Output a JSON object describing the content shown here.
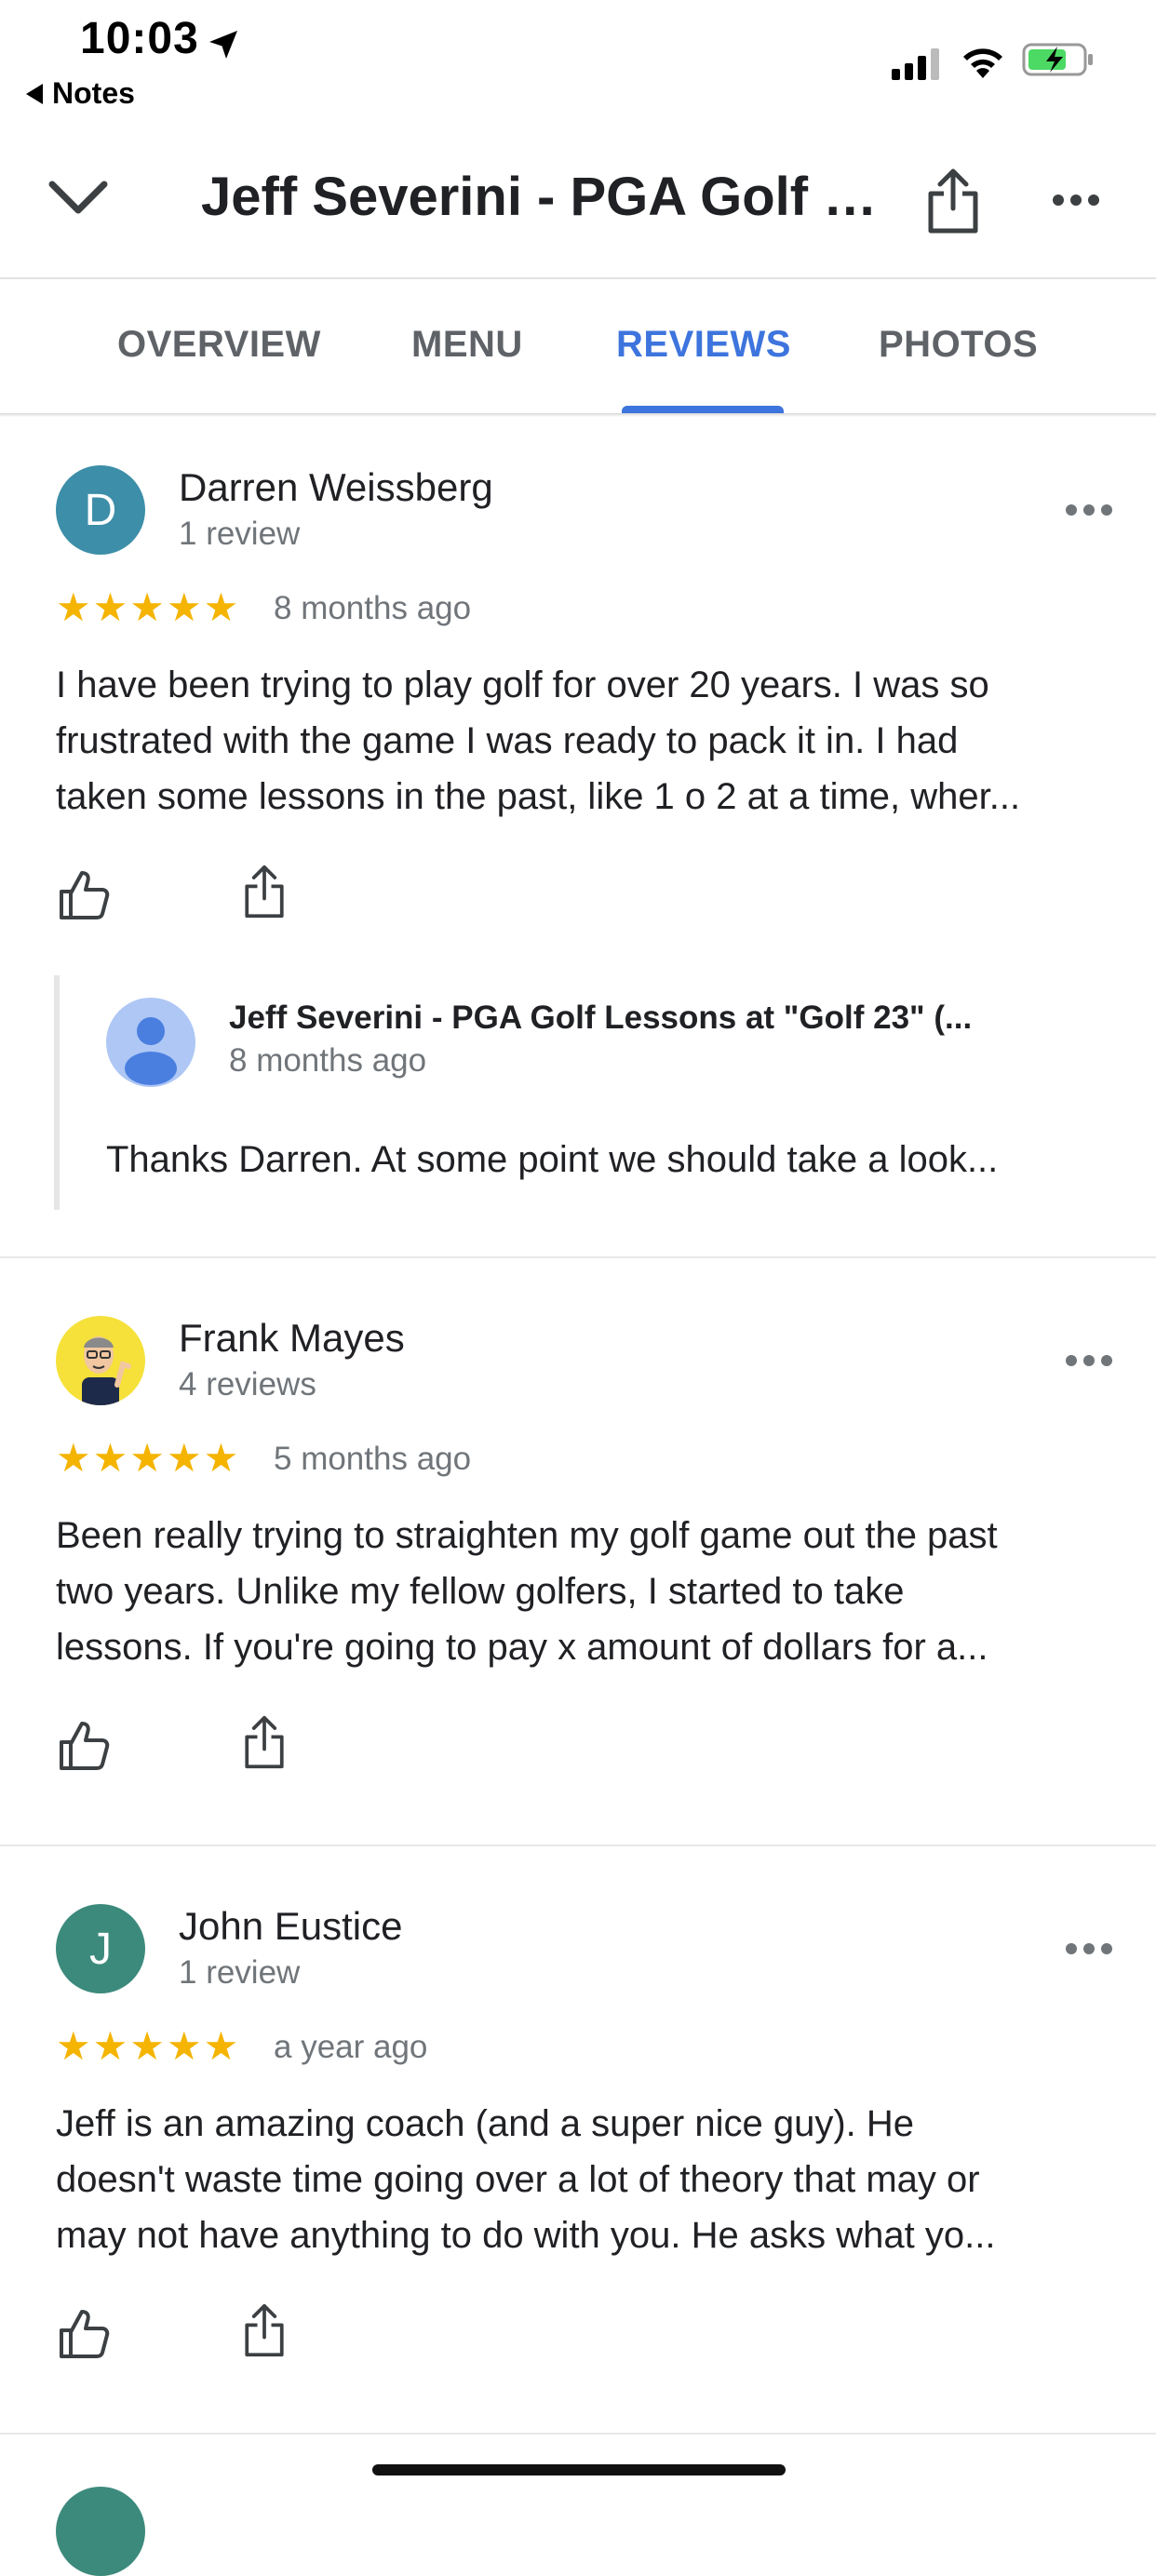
{
  "status_bar": {
    "time": "10:03",
    "back_label": "Notes"
  },
  "header": {
    "title": "Jeff Severini - PGA Golf L..."
  },
  "tabs": [
    {
      "label": "OVERVIEW",
      "active": false
    },
    {
      "label": "MENU",
      "active": false
    },
    {
      "label": "REVIEWS",
      "active": true
    },
    {
      "label": "PHOTOS",
      "active": false
    }
  ],
  "colors": {
    "accent": "#3d74dd",
    "star": "#f4b400",
    "avatar_d": "#3d8ea8",
    "avatar_j": "#3c8a7c"
  },
  "reviews": [
    {
      "avatar_letter": "D",
      "name": "Darren Weissberg",
      "count": "1 review",
      "stars": "★★★★★",
      "rating": 5,
      "time": "8 months ago",
      "lines": [
        "I have been trying to play golf for over 20 years.  I was so",
        "frustrated with the game I was ready to pack it in.  I had",
        "taken some lessons in the past, like 1 o 2 at a time, wher..."
      ],
      "reply": {
        "name": "Jeff Severini - PGA Golf Lessons at \"Golf 23\" (...",
        "time": "8 months ago",
        "text": "Thanks Darren.  At some point we should take a look..."
      }
    },
    {
      "avatar_letter": "",
      "name": "Frank Mayes",
      "count": "4 reviews",
      "stars": "★★★★★",
      "rating": 5,
      "time": "5 months ago",
      "lines": [
        "Been really trying to straighten my golf game out the past",
        "two years. Unlike my fellow golfers, I started to take",
        "lessons. If you're going to pay x amount of dollars for a..."
      ]
    },
    {
      "avatar_letter": "J",
      "name": "John Eustice",
      "count": "1 review",
      "stars": "★★★★★",
      "rating": 5,
      "time": "a year ago",
      "lines": [
        "Jeff is an amazing coach (and a super nice guy).  He",
        "doesn't waste time going over a lot of theory that may or",
        "may not have anything to do with you.  He asks what yo..."
      ]
    }
  ]
}
